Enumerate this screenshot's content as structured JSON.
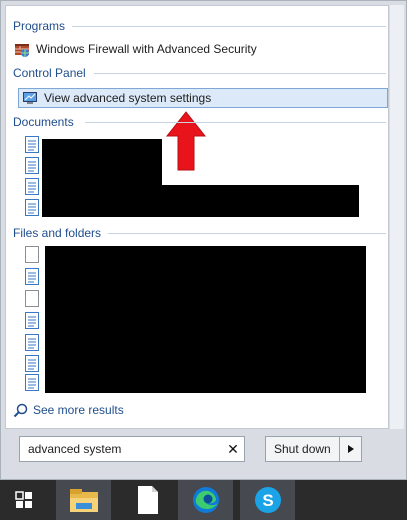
{
  "groups": {
    "programs": {
      "label": "Programs",
      "items": [
        "Windows Firewall with Advanced Security"
      ]
    },
    "control_panel": {
      "label": "Control Panel",
      "items": [
        "View advanced system settings"
      ]
    },
    "documents": {
      "label": "Documents"
    },
    "files": {
      "label": "Files and folders"
    }
  },
  "see_more": "See more results",
  "search": {
    "value": "advanced system",
    "clear": "✕"
  },
  "shutdown": {
    "label": "Shut down",
    "arrow": "▸"
  },
  "colors": {
    "group_label": "#1f4e8c",
    "highlight_bg": "#dbe9f8",
    "highlight_border": "#7ea7d6",
    "annotation_arrow": "#e8131b",
    "taskbar": "#2b2b2b"
  },
  "taskbar_items": [
    "start-icon",
    "file-explorer-icon",
    "document-icon",
    "edge-icon",
    "skype-icon"
  ]
}
